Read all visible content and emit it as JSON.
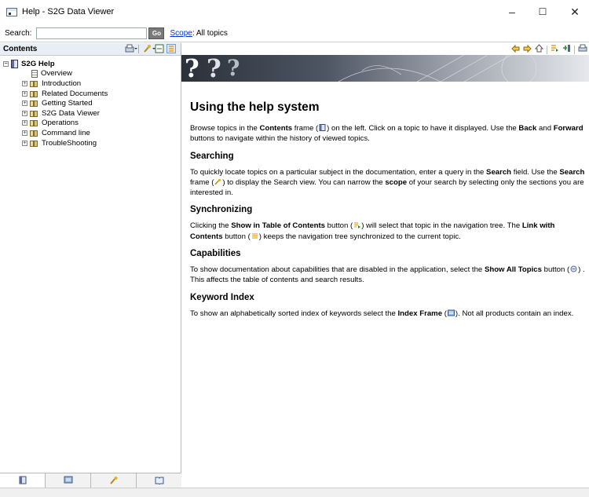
{
  "window": {
    "title": "Help - S2G Data Viewer",
    "minimize_glyph": "–",
    "maximize_glyph": "☐",
    "close_glyph": "✕"
  },
  "search": {
    "label": "Search:",
    "value": "",
    "placeholder": "",
    "go_label": "Go",
    "scope_link": "Scope",
    "scope_value": ": All topics"
  },
  "left": {
    "header": "Contents",
    "tree_root": "S2G Help",
    "tree_items": [
      {
        "label": "Overview",
        "type": "page"
      },
      {
        "label": "Introduction",
        "type": "book"
      },
      {
        "label": "Related Documents",
        "type": "book"
      },
      {
        "label": "Getting Started",
        "type": "book"
      },
      {
        "label": "S2G Data Viewer",
        "type": "book"
      },
      {
        "label": "Operations",
        "type": "book"
      },
      {
        "label": "Command line",
        "type": "book"
      },
      {
        "label": "TroubleShooting",
        "type": "book"
      }
    ],
    "bottom_tabs": [
      "contents-tab-icon",
      "index-tab-icon",
      "search-tab-icon",
      "bookmarks-tab-icon"
    ]
  },
  "banner": {
    "glyph1": "?",
    "glyph2": "?",
    "glyph3": "?"
  },
  "content": {
    "title": "Using the help system",
    "intro": {
      "a": "Browse topics in the ",
      "b": "Contents",
      "c": " frame (",
      "d": ") on the left. Click on a topic to have it displayed. Use the ",
      "e": "Back",
      "f": " and ",
      "g": "Forward",
      "h": " buttons to navigate within the history of viewed topics."
    },
    "searching": {
      "heading": "Searching",
      "a": "To quickly locate topics on a particular subject in the documentation, enter a query in the ",
      "b": "Search",
      "c": " field. Use the ",
      "d": "Search",
      "e": " frame (",
      "f": ") to display the Search view. You can narrow the ",
      "g": "scope",
      "h": " of your search by selecting only the sections you are interested in."
    },
    "sync": {
      "heading": "Synchronizing",
      "a": "Clicking the ",
      "b": "Show in Table of Contents",
      "c": " button (",
      "d": ") will select that topic in the navigation tree. The ",
      "e": "Link with Contents",
      "f": " button (",
      "g": ") keeps the navigation tree synchronized to the current topic."
    },
    "capabilities": {
      "heading": "Capabilities",
      "a": "To show documentation about capabilities that are disabled in the application, select the ",
      "b": "Show All Topics",
      "c": " button (",
      "d": ") . This affects the table of contents and search results."
    },
    "keyword": {
      "heading": "Keyword Index",
      "a": "To show an alphabetically sorted index of keywords select the ",
      "b": "Index Frame",
      "c": " (",
      "d": "). Not all products contain an index."
    }
  },
  "colors": {
    "link": "#0033cc",
    "banner_dark": "#2a313a",
    "banner_light": "#e6e8ec",
    "sync_button": "#3355cc"
  }
}
